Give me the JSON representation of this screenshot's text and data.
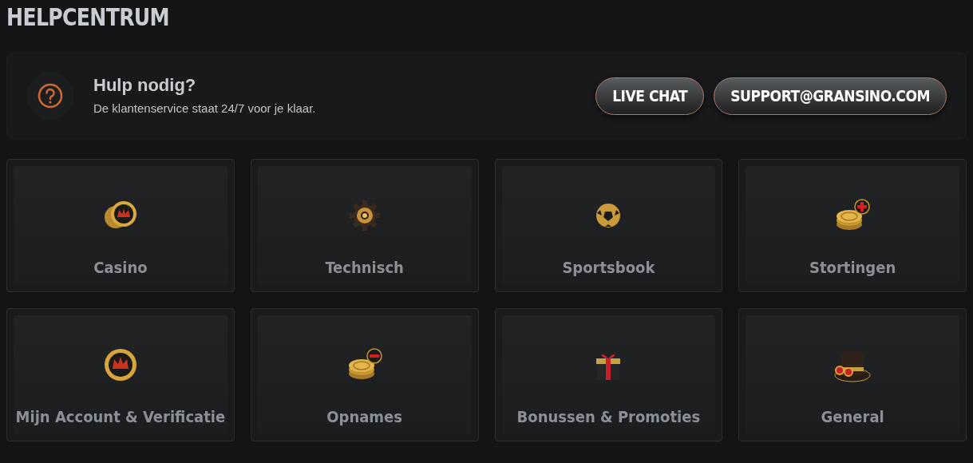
{
  "title": "HELPCENTRUM",
  "help": {
    "heading": "Hulp nodig?",
    "text": "De klantenservice staat 24/7 voor je klaar.",
    "buttons": [
      "LIVE CHAT",
      "SUPPORT@GRANSINO.COM"
    ]
  },
  "categories": [
    {
      "label": "Casino"
    },
    {
      "label": "Technisch"
    },
    {
      "label": "Sportsbook"
    },
    {
      "label": "Stortingen"
    },
    {
      "label": "Mijn Account & Verificatie"
    },
    {
      "label": "Opnames"
    },
    {
      "label": "Bonussen & Promoties"
    },
    {
      "label": "General"
    }
  ]
}
